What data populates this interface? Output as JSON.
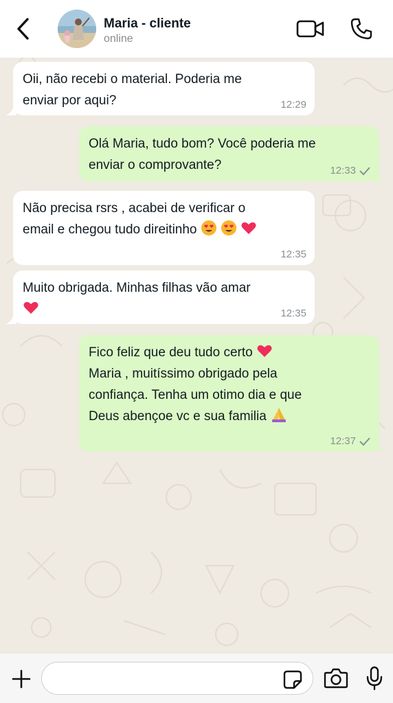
{
  "header": {
    "contact_name": "Maria - cliente",
    "contact_status": "online",
    "icons": [
      "back-icon",
      "avatar",
      "video-call-icon",
      "phone-icon"
    ]
  },
  "messages": [
    {
      "direction": "incoming",
      "text_lines": [
        "Oii, não recebi o material. Poderia me",
        "enviar por aqui?"
      ],
      "time": "12:29"
    },
    {
      "direction": "outgoing",
      "text_lines": [
        "Olá Maria, tudo bom? Você poderia me",
        "enviar o comprovante?"
      ],
      "time": "12:33",
      "status": "sent-check-icon"
    },
    {
      "direction": "incoming",
      "text_lines": [
        "Não precisa rsrs , acabei de verificar o",
        "email e chegou tudo direitinho"
      ],
      "emojis": [
        "heart-eyes-emoji",
        "heart-eyes-emoji",
        "red-heart-emoji"
      ],
      "time": "12:35"
    },
    {
      "direction": "incoming",
      "text_lines": [
        "Muito obrigada. Minhas filhas vão amar"
      ],
      "emojis": [
        "red-heart-emoji"
      ],
      "time": "12:35"
    },
    {
      "direction": "outgoing",
      "text_lines": [
        "Fico feliz que deu tudo certo",
        "Maria , muitíssimo obrigado pela",
        "confiança. Tenha um otimo dia e que",
        "Deus abençoe vc e sua familia"
      ],
      "emojis": [
        "red-heart-emoji",
        "folded-hands-emoji"
      ],
      "time": "12:37",
      "status": "sent-check-icon"
    }
  ],
  "composer": {
    "placeholder": "",
    "icons": [
      "plus-icon",
      "sticker-icon",
      "camera-icon",
      "microphone-icon"
    ]
  },
  "colors": {
    "chat_background": "#efeae2",
    "incoming_bubble": "#ffffff",
    "outgoing_bubble": "#dcf8c6",
    "timestamp": "#8a8f93"
  }
}
